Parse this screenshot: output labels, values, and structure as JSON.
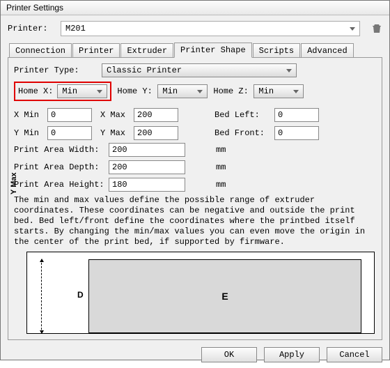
{
  "window": {
    "title": "Printer Settings"
  },
  "printer": {
    "label": "Printer:",
    "value": "M201"
  },
  "tabs": {
    "connection": "Connection",
    "printer": "Printer",
    "extruder": "Extruder",
    "printer_shape": "Printer Shape",
    "scripts": "Scripts",
    "advanced": "Advanced"
  },
  "printer_type": {
    "label": "Printer Type:",
    "value": "Classic Printer"
  },
  "home": {
    "x": {
      "label": "Home X:",
      "value": "Min"
    },
    "y": {
      "label": "Home Y:",
      "value": "Min"
    },
    "z": {
      "label": "Home Z:",
      "value": "Min"
    }
  },
  "limits": {
    "xmin": {
      "label": "X Min",
      "value": "0"
    },
    "xmax": {
      "label": "X Max",
      "value": "200"
    },
    "ymin": {
      "label": "Y Min",
      "value": "0"
    },
    "ymax": {
      "label": "Y Max",
      "value": "200"
    },
    "bed_left": {
      "label": "Bed Left:",
      "value": "0"
    },
    "bed_front": {
      "label": "Bed Front:",
      "value": "0"
    }
  },
  "area": {
    "width": {
      "label": "Print Area Width:",
      "value": "200",
      "unit": "mm"
    },
    "depth": {
      "label": "Print Area Depth:",
      "value": "200",
      "unit": "mm"
    },
    "height": {
      "label": "Print Area Height:",
      "value": "180",
      "unit": "mm"
    }
  },
  "description": "The min and max values define the possible range of extruder coordinates. These coordinates can be negative and outside the print bed. Bed left/front define the coordinates where the printbed itself starts. By changing the min/max values you can even move the origin in the center of the print bed, if supported by firmware.",
  "diagram": {
    "ymax": "Y Max",
    "d": "D",
    "e": "E"
  },
  "buttons": {
    "ok": "OK",
    "apply": "Apply",
    "cancel": "Cancel"
  }
}
